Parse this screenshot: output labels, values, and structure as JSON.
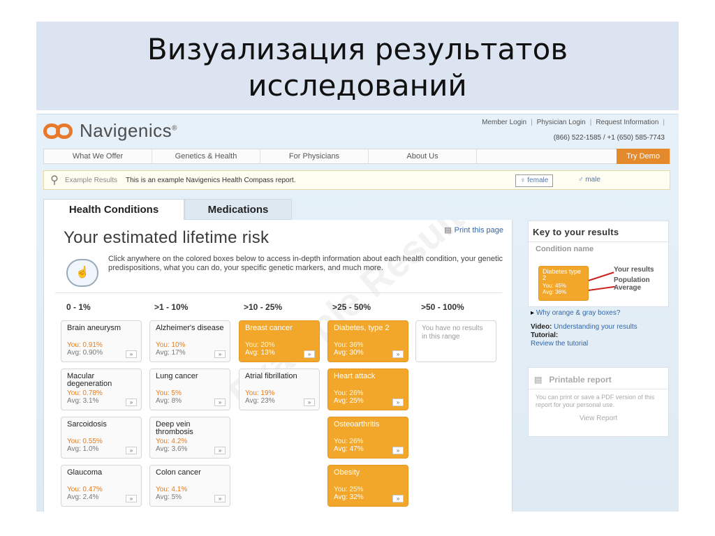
{
  "slide": {
    "title_line1": "Визуализация результатов",
    "title_line2": "исследований"
  },
  "header": {
    "logo_text": "Navigenics",
    "logo_mark": "®",
    "member_login": "Member Login",
    "physician_login": "Physician Login",
    "request_information": "Request Information",
    "separator": "|",
    "phone": "(866) 522-1585 / +1 (650) 585-7743"
  },
  "nav": {
    "items": [
      "What We Offer",
      "Genetics & Health",
      "For Physicians",
      "About Us"
    ],
    "try_demo": "Try Demo"
  },
  "example_bar": {
    "label": "Example Results",
    "text": "This is an example Navigenics Health Compass report.",
    "female_label": "female",
    "male_label": "male"
  },
  "tabs": [
    "Health Conditions",
    "Medications"
  ],
  "main": {
    "title": "Your estimated lifetime risk",
    "print_link": "Print this page",
    "intro": "Click anywhere on the colored boxes below to access in-depth information about each health condition, your genetic predispositions, what you can do, your specific genetic markers, and much more.",
    "watermark": "Example Results",
    "ranges": [
      "0 - 1%",
      ">1 - 10%",
      ">10 - 25%",
      ">25 - 50%",
      ">50 - 100%"
    ],
    "empty_text": "You have no results in this range",
    "columns": [
      [
        {
          "name": "Brain aneurysm",
          "you": "You: 0.91%",
          "avg": "Avg: 0.90%"
        },
        {
          "name": "Macular degeneration",
          "you": "You: 0.78%",
          "avg": "Avg: 3.1%"
        },
        {
          "name": "Sarcoidosis",
          "you": "You: 0.55%",
          "avg": "Avg: 1.0%"
        },
        {
          "name": "Glaucoma",
          "you": "You: 0.47%",
          "avg": "Avg: 2.4%"
        }
      ],
      [
        {
          "name": "Alzheimer's disease",
          "you": "You: 10%",
          "avg": "Avg: 17%"
        },
        {
          "name": "Lung cancer",
          "you": "You: 5%",
          "avg": "Avg: 8%"
        },
        {
          "name": "Deep vein thrombosis",
          "you": "You: 4.2%",
          "avg": "Avg: 3.6%"
        },
        {
          "name": "Colon cancer",
          "you": "You: 4.1%",
          "avg": "Avg: 5%"
        }
      ],
      [
        {
          "name": "Breast cancer",
          "you": "You: 20%",
          "avg": "Avg: 13%"
        },
        {
          "name": "Atrial fibrillation",
          "you": "You: 19%",
          "avg": "Avg: 23%"
        }
      ],
      [
        {
          "name": "Diabetes, type 2",
          "you": "You: 36%",
          "avg": "Avg: 30%"
        },
        {
          "name": "Heart attack",
          "you": "You: 26%",
          "avg": "Avg: 25%"
        },
        {
          "name": "Osteoarthritis",
          "you": "You: 26%",
          "avg": "Avg: 47%"
        },
        {
          "name": "Obesity",
          "you": "You: 25%",
          "avg": "Avg: 32%"
        }
      ]
    ],
    "go_symbol": "»"
  },
  "key": {
    "title": "Key to your results",
    "condition_name": "Condition name",
    "box_name": "Diabetes type 2",
    "box_you": "You: 45%",
    "box_avg": "Avg: 36%",
    "your_results": "Your results",
    "population_average": "Population Average",
    "why_link": "Why orange & gray boxes?",
    "video_label": "Video:",
    "video_link": "Understanding your results",
    "tutorial_label": "Tutorial:",
    "tutorial_link": "Review the tutorial"
  },
  "printable": {
    "title": "Printable report",
    "text": "You can print or save a PDF version of this report for your personal use.",
    "button": "View Report"
  },
  "colors": {
    "accent_orange": "#f3a72a",
    "logo_orange": "#e8782a",
    "link_blue": "#3366aa"
  }
}
